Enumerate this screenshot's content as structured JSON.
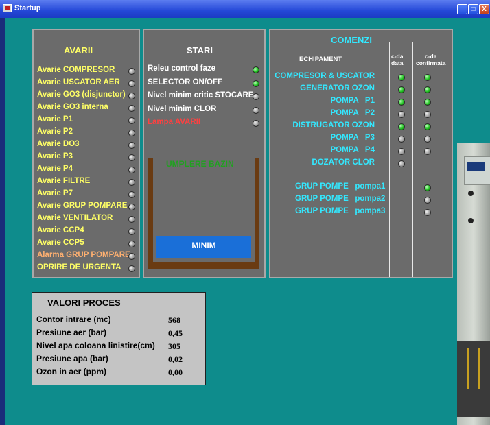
{
  "window": {
    "title": "Startup",
    "min_glyph": "_",
    "max_glyph": "□",
    "close_glyph": "X"
  },
  "avarii": {
    "title": "AVARII",
    "items": [
      {
        "label": "Avarie COMPRESOR",
        "color": "yellow",
        "state": "off"
      },
      {
        "label": "Avarie USCATOR AER",
        "color": "yellow",
        "state": "off"
      },
      {
        "label": "Avarie GO3 (disjunctor)",
        "color": "yellow",
        "state": "off"
      },
      {
        "label": "Avarie GO3 interna",
        "color": "yellow",
        "state": "off"
      },
      {
        "label": "Avarie P1",
        "color": "yellow",
        "state": "off"
      },
      {
        "label": "Avarie P2",
        "color": "yellow",
        "state": "off"
      },
      {
        "label": "Avarie DO3",
        "color": "yellow",
        "state": "off"
      },
      {
        "label": "Avarie P3",
        "color": "yellow",
        "state": "off"
      },
      {
        "label": "Avarie P4",
        "color": "yellow",
        "state": "off"
      },
      {
        "label": "Avarie FILTRE",
        "color": "yellow",
        "state": "off"
      },
      {
        "label": "Avarie P7",
        "color": "yellow",
        "state": "off"
      },
      {
        "label": "Avarie GRUP POMPARE",
        "color": "yellow",
        "state": "off"
      },
      {
        "label": "Avarie VENTILATOR",
        "color": "yellow",
        "state": "off"
      },
      {
        "label": "Avarie CCP4",
        "color": "yellow",
        "state": "off"
      },
      {
        "label": "Avarie CCP5",
        "color": "yellow",
        "state": "off"
      },
      {
        "label": "Alarma GRUP POMPARE",
        "color": "orange",
        "state": "off"
      },
      {
        "label": "OPRIRE DE URGENTA",
        "color": "yellow",
        "state": "off"
      }
    ]
  },
  "stari": {
    "title": "STARI",
    "items": [
      {
        "label": "Releu control faze",
        "color": "white",
        "state": "on"
      },
      {
        "label": "SELECTOR ON/OFF",
        "color": "white",
        "state": "on"
      },
      {
        "label": "Nivel minim critic STOCARE",
        "color": "white",
        "state": "off"
      },
      {
        "label": "Nivel minim CLOR",
        "color": "white",
        "state": "off"
      },
      {
        "label": "Lampa AVARII",
        "color": "red",
        "state": "off"
      }
    ],
    "tank": {
      "label": "UMPLERE BAZIN",
      "level_label": "MINIM"
    }
  },
  "comenzi": {
    "title": "COMENZI",
    "col_equipment": "ECHIPAMENT",
    "col_cmd": "c-da\ndata",
    "col_confirm": "c-da\nconfirmata",
    "items": [
      {
        "label": "COMPRESOR & USCATOR",
        "cmd": "on",
        "confirm": "on"
      },
      {
        "label": "GENERATOR OZON",
        "cmd": "on",
        "confirm": "on"
      },
      {
        "label": "POMPA   P1",
        "cmd": "on",
        "confirm": "on"
      },
      {
        "label": "POMPA   P2",
        "cmd": "off",
        "confirm": "off"
      },
      {
        "label": "DISTRUGATOR OZON",
        "cmd": "on",
        "confirm": "on"
      },
      {
        "label": "POMPA   P3",
        "cmd": "off",
        "confirm": "off"
      },
      {
        "label": "POMPA   P4",
        "cmd": "off",
        "confirm": "off"
      },
      {
        "label": "DOZATOR CLOR",
        "cmd": "off",
        "confirm": null
      }
    ],
    "groups": [
      {
        "label": "GRUP POMPE   pompa1",
        "confirm": "on"
      },
      {
        "label": "GRUP POMPE   pompa2",
        "confirm": "off"
      },
      {
        "label": "GRUP POMPE   pompa3",
        "confirm": "off"
      }
    ]
  },
  "valori": {
    "title": "VALORI PROCES",
    "rows": [
      {
        "label": "Contor intrare (mc)",
        "value": "568"
      },
      {
        "label": "Presiune aer (bar)",
        "value": "0,45"
      },
      {
        "label": "Nivel apa coloana linistire(cm)",
        "value": "305"
      },
      {
        "label": "Presiune apa (bar)",
        "value": "0,02"
      },
      {
        "label": "Ozon in aer (ppm)",
        "value": "0,00"
      }
    ]
  },
  "colors": {
    "background": "#0e8c8c",
    "panel": "#6b6b6b",
    "led_on": "#22c022",
    "led_off": "#9a9a9a",
    "label_yellow": "#ffff66",
    "label_cyan": "#33e8ff",
    "water": "#1a6fd8",
    "tank": "#6a3b12"
  }
}
